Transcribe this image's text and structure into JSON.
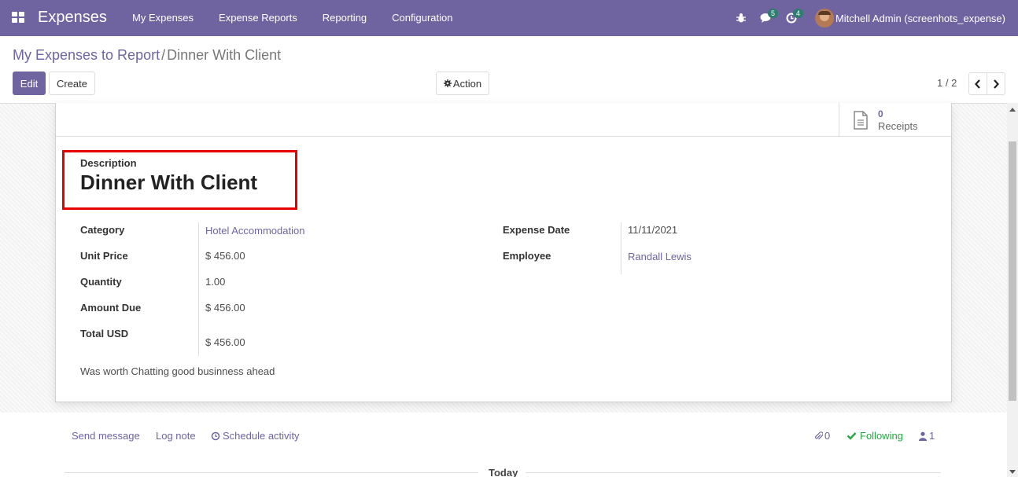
{
  "navbar": {
    "brand": "Expenses",
    "menu": [
      "My Expenses",
      "Expense Reports",
      "Reporting",
      "Configuration"
    ],
    "messages_count": "5",
    "activities_count": "4",
    "user": "Mitchell Admin (screenhots_expense)"
  },
  "control_panel": {
    "breadcrumb_parent": "My Expenses to Report",
    "breadcrumb_sep": "/",
    "breadcrumb_current": "Dinner With Client",
    "edit_label": "Edit",
    "create_label": "Create",
    "action_label": "Action",
    "pager": "1 / 2"
  },
  "form": {
    "receipts_count": "0",
    "receipts_label": "Receipts",
    "description_label": "Description",
    "description": "Dinner With Client",
    "left_fields": [
      {
        "label": "Category",
        "value": "Hotel Accommodation"
      },
      {
        "label": "Unit Price",
        "value": "$ 456.00"
      },
      {
        "label": "Quantity",
        "value": "1.00"
      },
      {
        "label": "Amount Due",
        "value": "$ 456.00"
      },
      {
        "label": "Total USD",
        "value": "$ 456.00"
      }
    ],
    "right_fields": [
      {
        "label": "Expense Date",
        "value": "11/11/2021"
      },
      {
        "label": "Employee",
        "value": "Randall Lewis"
      }
    ],
    "notes": "Was worth Chatting good businness ahead"
  },
  "chatter": {
    "send_message": "Send message",
    "log_note": "Log note",
    "schedule_activity": "Schedule activity",
    "attachments": "0",
    "following": "Following",
    "followers": "1",
    "today": "Today"
  },
  "colors": {
    "brand": "#6f64a0",
    "highlight": "#e60000",
    "following": "#28a745"
  }
}
